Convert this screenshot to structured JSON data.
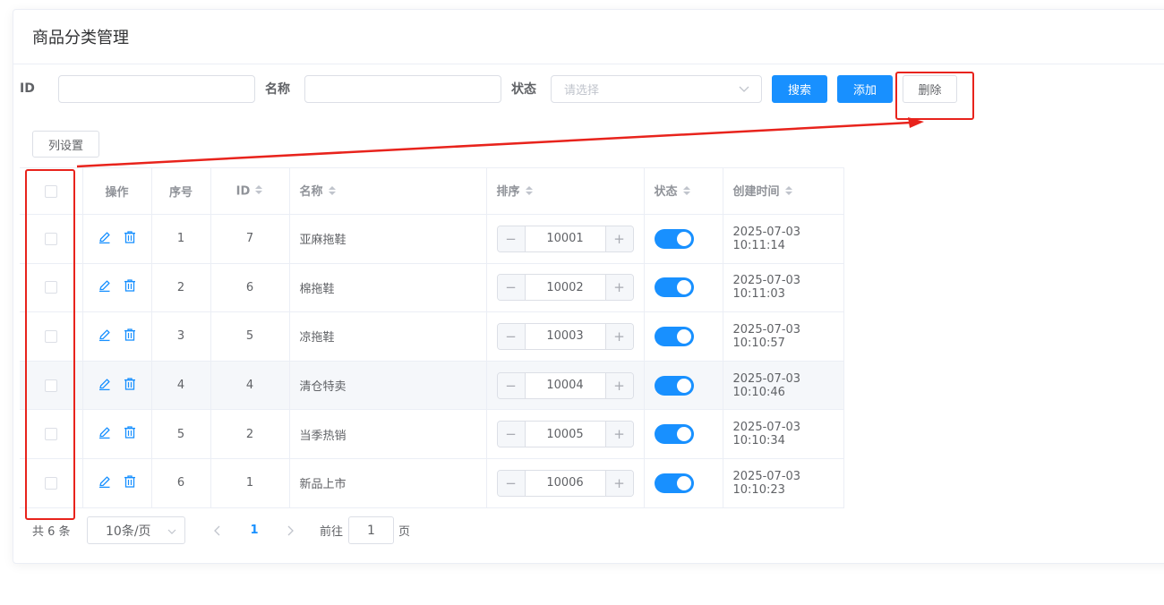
{
  "page": {
    "title": "商品分类管理"
  },
  "search": {
    "id_label": "ID",
    "id_value": "",
    "name_label": "名称",
    "name_value": "",
    "status_label": "状态",
    "status_placeholder": "请选择",
    "search_button": "搜索",
    "add_button": "添加",
    "delete_button": "删除"
  },
  "column_settings_button": "列设置",
  "table": {
    "headers": {
      "actions": "操作",
      "index": "序号",
      "id": "ID",
      "name": "名称",
      "sort": "排序",
      "status": "状态",
      "created": "创建时间"
    },
    "rows": [
      {
        "index": "1",
        "id": "7",
        "name": "亚麻拖鞋",
        "sort": "10001",
        "status_on": true,
        "created": "2025-07-03 10:11:14"
      },
      {
        "index": "2",
        "id": "6",
        "name": "棉拖鞋",
        "sort": "10002",
        "status_on": true,
        "created": "2025-07-03 10:11:03"
      },
      {
        "index": "3",
        "id": "5",
        "name": "凉拖鞋",
        "sort": "10003",
        "status_on": true,
        "created": "2025-07-03 10:10:57"
      },
      {
        "index": "4",
        "id": "4",
        "name": "清仓特卖",
        "sort": "10004",
        "status_on": true,
        "created": "2025-07-03 10:10:46"
      },
      {
        "index": "5",
        "id": "2",
        "name": "当季热销",
        "sort": "10005",
        "status_on": true,
        "created": "2025-07-03 10:10:34"
      },
      {
        "index": "6",
        "id": "1",
        "name": "新品上市",
        "sort": "10006",
        "status_on": true,
        "created": "2025-07-03 10:10:23"
      }
    ],
    "hover_row": 3,
    "step_minus": "−",
    "step_plus": "+"
  },
  "pagination": {
    "total": "共 6 条",
    "page_size": "10条/页",
    "current_page": "1",
    "goto_label": "前往",
    "goto_value": "1",
    "page_suffix": "页"
  },
  "colors": {
    "primary": "#1890ff",
    "annotation_red": "#e8231c"
  }
}
